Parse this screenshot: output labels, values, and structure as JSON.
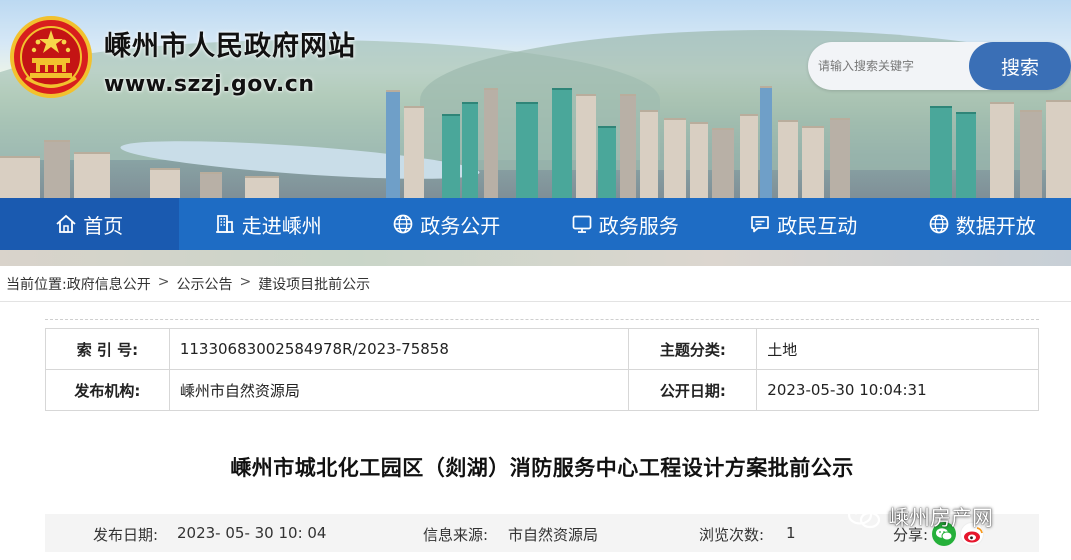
{
  "header": {
    "site_title": "嵊州市人民政府网站",
    "site_url": "www.szzj.gov.cn",
    "emblem_icon": "national-emblem-icon"
  },
  "search": {
    "placeholder": "请输入搜索关键字",
    "button_label": "搜索"
  },
  "nav": {
    "items": [
      {
        "label": "首页",
        "icon": "home-icon",
        "active": true
      },
      {
        "label": "走进嵊州",
        "icon": "building-icon"
      },
      {
        "label": "政务公开",
        "icon": "globe-icon"
      },
      {
        "label": "政务服务",
        "icon": "monitor-icon"
      },
      {
        "label": "政民互动",
        "icon": "chat-icon"
      },
      {
        "label": "数据开放",
        "icon": "globe-icon"
      }
    ]
  },
  "breadcrumb": {
    "prefix": "当前位置:",
    "items": [
      "政府信息公开",
      "公示公告",
      "建设项目批前公示"
    ],
    "separator": ">"
  },
  "meta": {
    "index_label": "索 引 号:",
    "index_value": "11330683002584978R/2023-75858",
    "topic_label": "主题分类:",
    "topic_value": "土地",
    "publisher_label": "发布机构:",
    "publisher_value": "嵊州市自然资源局",
    "open_date_label": "公开日期:",
    "open_date_value": "2023-05-30 10:04:31"
  },
  "article": {
    "title": "嵊州市城北化工园区（剡湖）消防服务中心工程设计方案批前公示",
    "publish_date_label": "发布日期:",
    "publish_date_value": "2023- 05- 30 10: 04",
    "source_label": "信息来源:",
    "source_value": "市自然资源局",
    "views_label": "浏览次数:",
    "views_value": "1",
    "share_label": "分享:"
  },
  "watermark": {
    "text": "嵊州房产网"
  },
  "colors": {
    "nav_bg": "#1e6cc4",
    "nav_active": "#1a5ab0",
    "search_button": "#3a6fb6"
  }
}
